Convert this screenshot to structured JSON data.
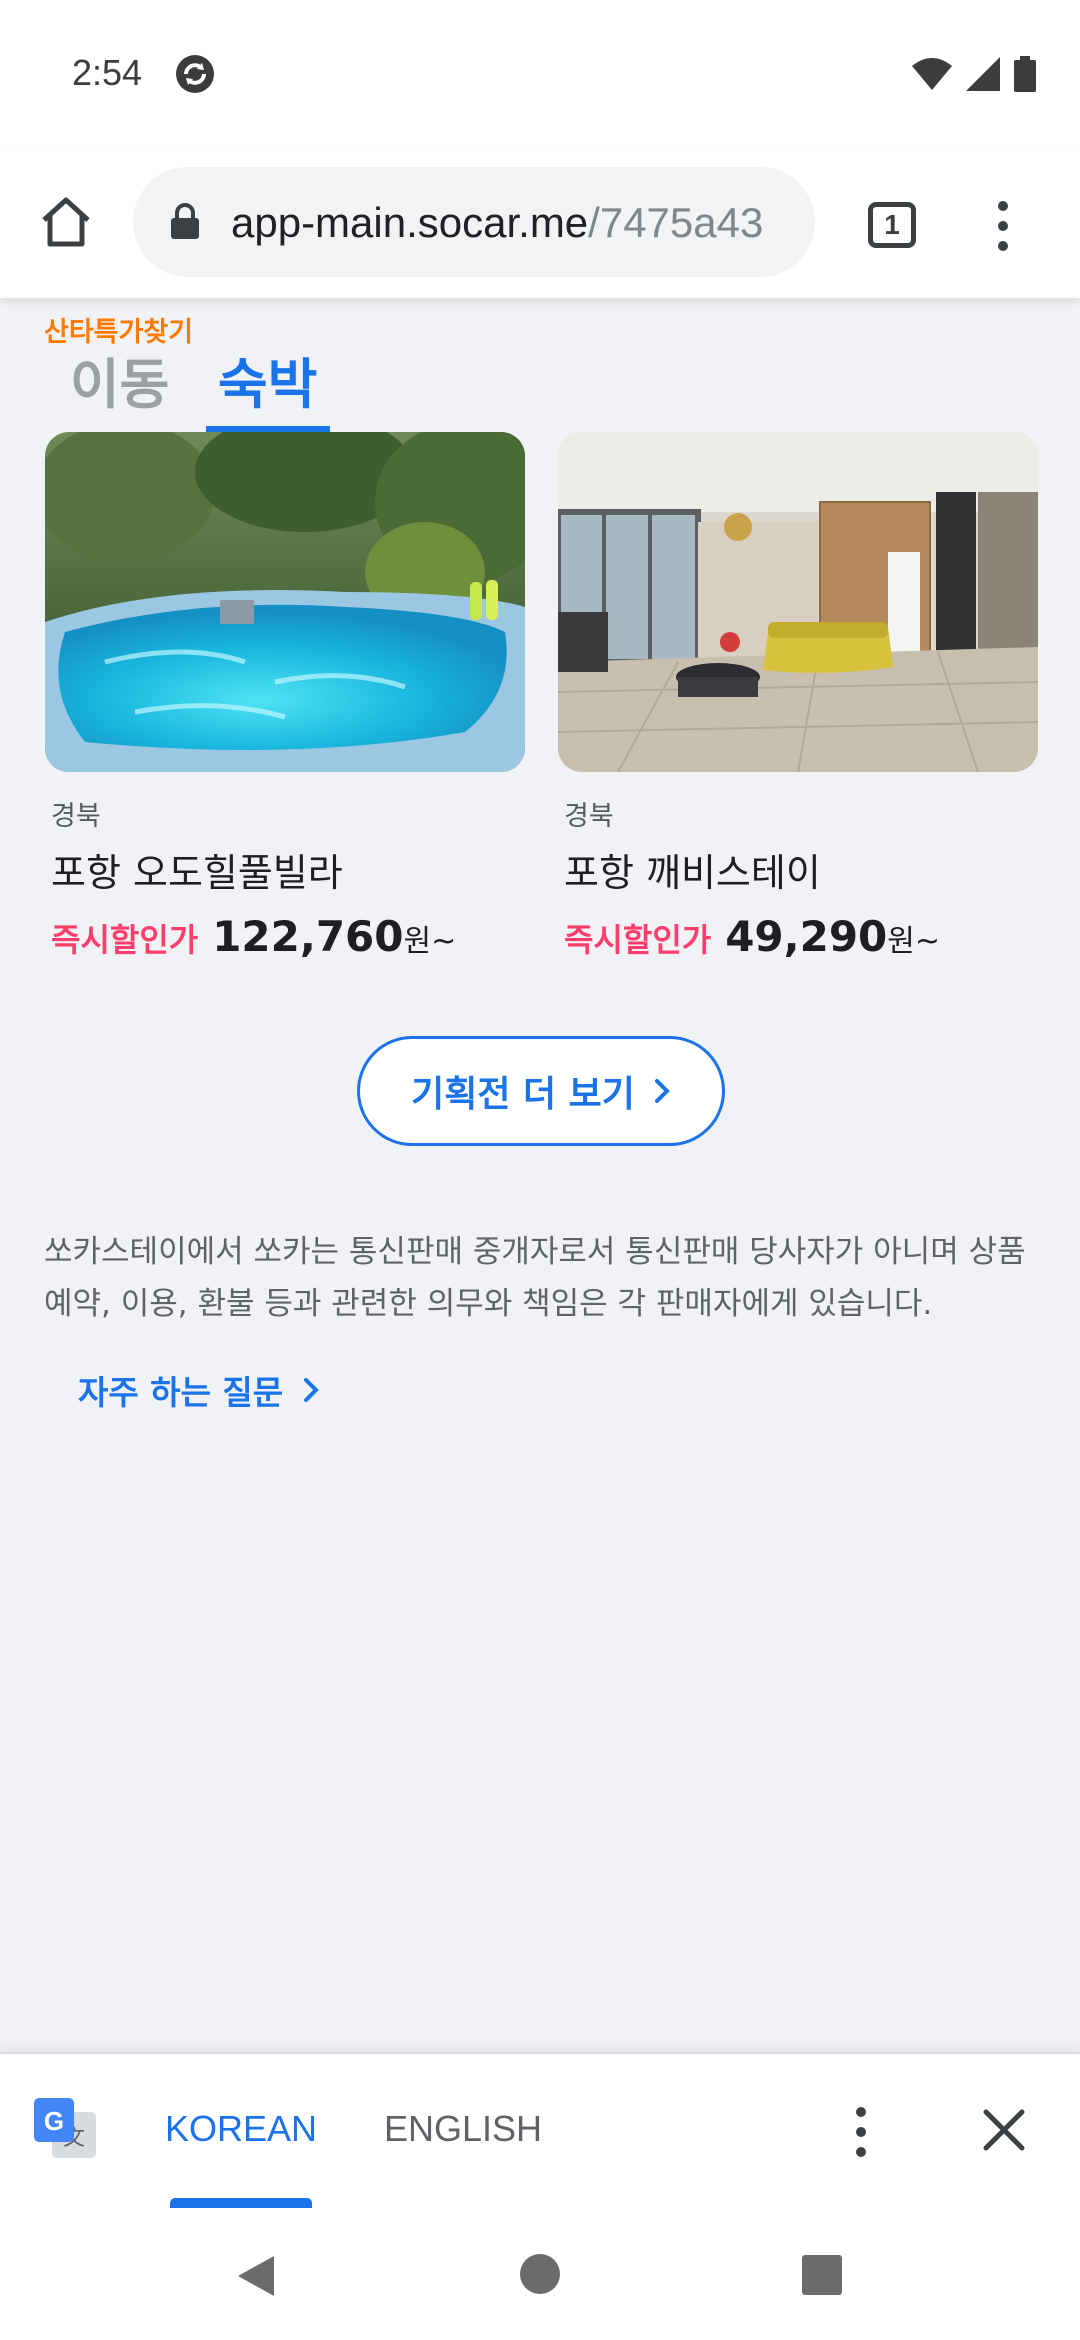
{
  "status_bar": {
    "time": "2:54"
  },
  "browser": {
    "url_host": "app-main.socar.me",
    "url_path": "/7475a43",
    "tab_count": "1"
  },
  "page": {
    "section_label": "산타특가찾기",
    "tabs": [
      {
        "label": "이동",
        "selected": false
      },
      {
        "label": "숙박",
        "selected": true
      }
    ],
    "cards": [
      {
        "region": "경북",
        "name": "포항 오도힐풀빌라",
        "price_label": "즉시할인가",
        "price": "122,760",
        "price_suffix": "원~",
        "image": "outdoor-jacuzzi-pool-photo"
      },
      {
        "region": "경북",
        "name": "포항 깨비스테이",
        "price_label": "즉시할인가",
        "price": "49,290",
        "price_suffix": "원~",
        "image": "living-room-interior-photo"
      }
    ],
    "more_button": "기획전 더 보기",
    "notice": "쏘카스테이에서 쏘카는 통신판매 중개자로서 통신판매 당사자가 아니며 상품 예약, 이용, 환불 등과 관련한 의무와 책임은 각 판매자에게 있습니다.",
    "faq_link": "자주 하는 질문"
  },
  "translate_bar": {
    "languages": [
      "KOREAN",
      "ENGLISH"
    ],
    "selected": "KOREAN"
  },
  "colors": {
    "accent": "#1a73e8",
    "discount": "#ff3e6c",
    "section_label": "#ff7a00",
    "page_bg": "#f1f2f5"
  }
}
